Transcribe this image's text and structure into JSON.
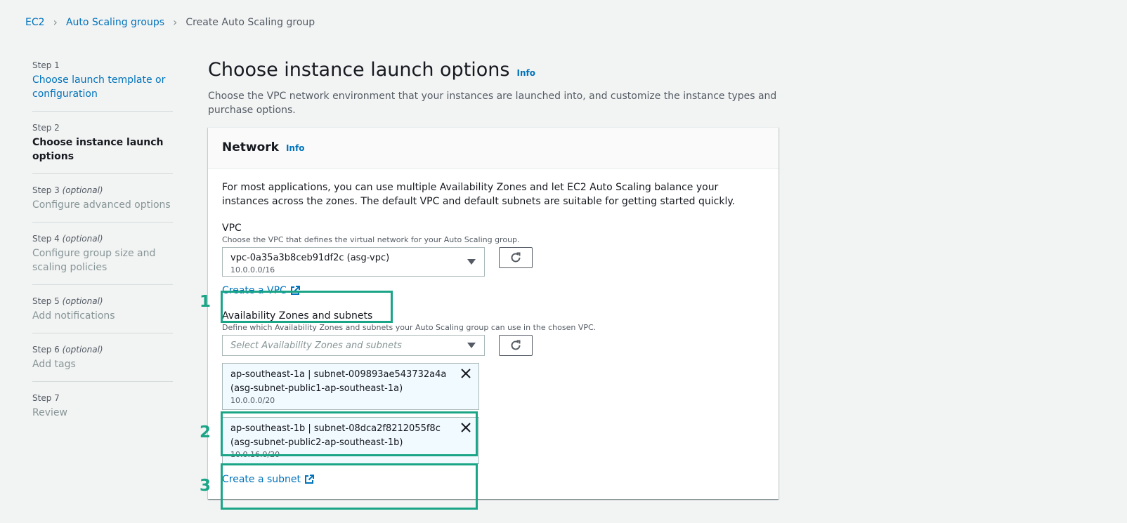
{
  "breadcrumb": {
    "items": [
      "EC2",
      "Auto Scaling groups"
    ],
    "current": "Create Auto Scaling group"
  },
  "steps": [
    {
      "num": "Step 1",
      "optional": "",
      "title": "Choose launch template or configuration",
      "state": "link"
    },
    {
      "num": "Step 2",
      "optional": "",
      "title": "Choose instance launch options",
      "state": "active"
    },
    {
      "num": "Step 3",
      "optional": "(optional)",
      "title": "Configure advanced options",
      "state": "disabled"
    },
    {
      "num": "Step 4",
      "optional": "(optional)",
      "title": "Configure group size and scaling policies",
      "state": "disabled"
    },
    {
      "num": "Step 5",
      "optional": "(optional)",
      "title": "Add notifications",
      "state": "disabled"
    },
    {
      "num": "Step 6",
      "optional": "(optional)",
      "title": "Add tags",
      "state": "disabled"
    },
    {
      "num": "Step 7",
      "optional": "",
      "title": "Review",
      "state": "disabled"
    }
  ],
  "page": {
    "title": "Choose instance launch options",
    "info": "Info",
    "description": "Choose the VPC network environment that your instances are launched into, and customize the instance types and purchase options."
  },
  "network": {
    "title": "Network",
    "info": "Info",
    "description": "For most applications, you can use multiple Availability Zones and let EC2 Auto Scaling balance your instances across the zones. The default VPC and default subnets are suitable for getting started quickly.",
    "vpc": {
      "label": "VPC",
      "description": "Choose the VPC that defines the virtual network for your Auto Scaling group.",
      "value": "vpc-0a35a3b8ceb91df2c (asg-vpc)",
      "cidr": "10.0.0.0/16",
      "create_link": "Create a VPC"
    },
    "azs": {
      "label": "Availability Zones and subnets",
      "description": "Define which Availability Zones and subnets your Auto Scaling group can use in the chosen VPC.",
      "placeholder": "Select Availability Zones and subnets",
      "tokens": [
        {
          "line1": "ap-southeast-1a | subnet-009893ae543732a4a",
          "line2": "(asg-subnet-public1-ap-southeast-1a)",
          "cidr": "10.0.0.0/20"
        },
        {
          "line1": "ap-southeast-1b | subnet-08dca2f8212055f8c",
          "line2": "(asg-subnet-public2-ap-southeast-1b)",
          "cidr": "10.0.16.0/20"
        }
      ],
      "create_link": "Create a subnet"
    }
  },
  "markers": [
    "1",
    "2",
    "3"
  ],
  "colors": {
    "accent": "#1aa587",
    "link": "#0073bb"
  }
}
